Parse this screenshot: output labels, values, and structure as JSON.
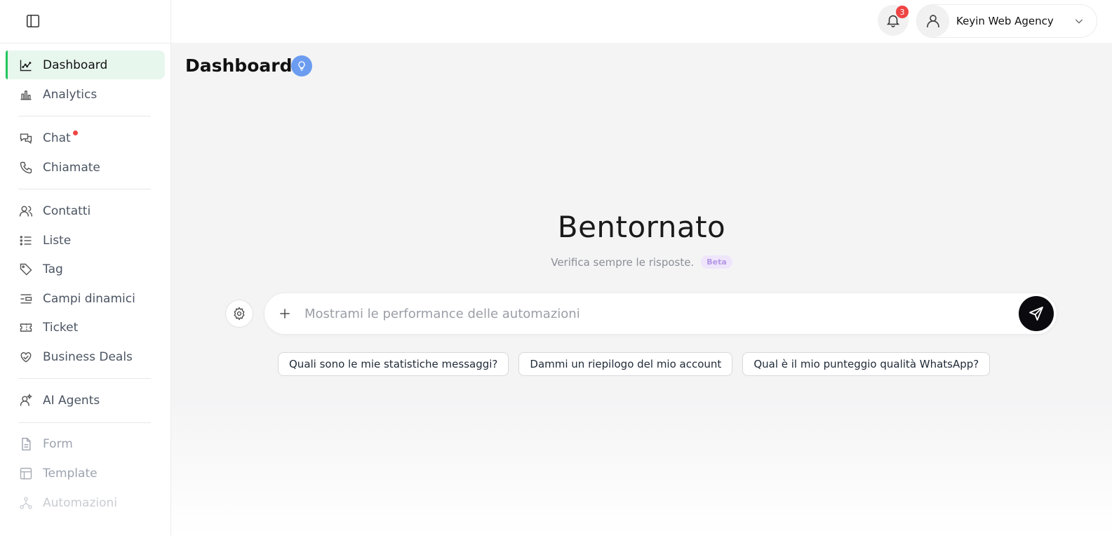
{
  "sidebar": {
    "items": [
      {
        "label": "Dashboard",
        "icon": "line-chart-icon"
      },
      {
        "label": "Analytics",
        "icon": "bar-chart-icon"
      },
      {
        "label": "Chat",
        "icon": "chat-bubbles-icon"
      },
      {
        "label": "Chiamate",
        "icon": "phone-icon"
      },
      {
        "label": "Contatti",
        "icon": "users-icon"
      },
      {
        "label": "Liste",
        "icon": "list-icon"
      },
      {
        "label": "Tag",
        "icon": "tag-icon"
      },
      {
        "label": "Campi dinamici",
        "icon": "dynamic-fields-icon"
      },
      {
        "label": "Ticket",
        "icon": "ticket-icon"
      },
      {
        "label": "Business Deals",
        "icon": "handshake-icon"
      },
      {
        "label": "AI Agents",
        "icon": "ai-agent-icon"
      },
      {
        "label": "Form",
        "icon": "document-icon"
      },
      {
        "label": "Template",
        "icon": "layout-icon"
      },
      {
        "label": "Automazioni",
        "icon": "automation-icon"
      }
    ]
  },
  "header": {
    "notifications_count": "3",
    "account_name": "Keyin Web Agency"
  },
  "main": {
    "page_title": "Dashboard",
    "welcome": "Bentornato",
    "subtext": "Verifica sempre le risposte.",
    "beta": "Beta",
    "prompt_placeholder": "Mostrami le performance delle automazioni",
    "suggestions": [
      "Quali sono le mie statistiche messaggi?",
      "Dammi un riepilogo del mio account",
      "Qual è il mio punteggio qualità WhatsApp?"
    ]
  },
  "colors": {
    "accent": "#22c55e",
    "active_bg": "#e8f7ee",
    "badge": "#ef4444",
    "bulb": "#6b9cf0",
    "send": "#0b0b0f"
  }
}
